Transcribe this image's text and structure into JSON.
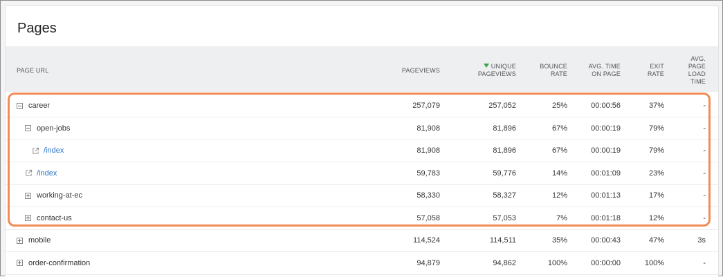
{
  "title": "Pages",
  "columns": {
    "page_url": "PAGE URL",
    "pageviews": "PAGEVIEWS",
    "unique_pageviews": [
      "UNIQUE",
      "PAGEVIEWS"
    ],
    "bounce_rate": [
      "BOUNCE",
      "RATE"
    ],
    "avg_time": [
      "AVG. TIME",
      "ON PAGE"
    ],
    "exit_rate": [
      "EXIT",
      "RATE"
    ],
    "avg_load": [
      "AVG.",
      "PAGE",
      "LOAD",
      "TIME"
    ]
  },
  "sort_color": "#3aa548",
  "link_color": "#2a73c5",
  "highlight_color": "#f28b55",
  "rows": [
    {
      "label": "career",
      "type": "minus",
      "pageviews": "257,079",
      "unique": "257,052",
      "bounce": "25%",
      "avg_time": "00:00:56",
      "exit": "37%",
      "load": "-"
    },
    {
      "label": "open-jobs",
      "type": "minus",
      "pageviews": "81,908",
      "unique": "81,896",
      "bounce": "67%",
      "avg_time": "00:00:19",
      "exit": "79%",
      "load": "-"
    },
    {
      "label": "/index",
      "type": "link",
      "pageviews": "81,908",
      "unique": "81,896",
      "bounce": "67%",
      "avg_time": "00:00:19",
      "exit": "79%",
      "load": "-"
    },
    {
      "label": "/index",
      "type": "link",
      "pageviews": "59,783",
      "unique": "59,776",
      "bounce": "14%",
      "avg_time": "00:01:09",
      "exit": "23%",
      "load": "-"
    },
    {
      "label": "working-at-ec",
      "type": "plus",
      "pageviews": "58,330",
      "unique": "58,327",
      "bounce": "12%",
      "avg_time": "00:01:13",
      "exit": "17%",
      "load": "-"
    },
    {
      "label": "contact-us",
      "type": "plus",
      "pageviews": "57,058",
      "unique": "57,053",
      "bounce": "7%",
      "avg_time": "00:01:18",
      "exit": "12%",
      "load": "-"
    },
    {
      "label": "mobile",
      "type": "plus",
      "pageviews": "114,524",
      "unique": "114,511",
      "bounce": "35%",
      "avg_time": "00:00:43",
      "exit": "47%",
      "load": "3s"
    },
    {
      "label": "order-confirmation",
      "type": "plus",
      "pageviews": "94,879",
      "unique": "94,862",
      "bounce": "100%",
      "avg_time": "00:00:00",
      "exit": "100%",
      "load": "-"
    }
  ]
}
